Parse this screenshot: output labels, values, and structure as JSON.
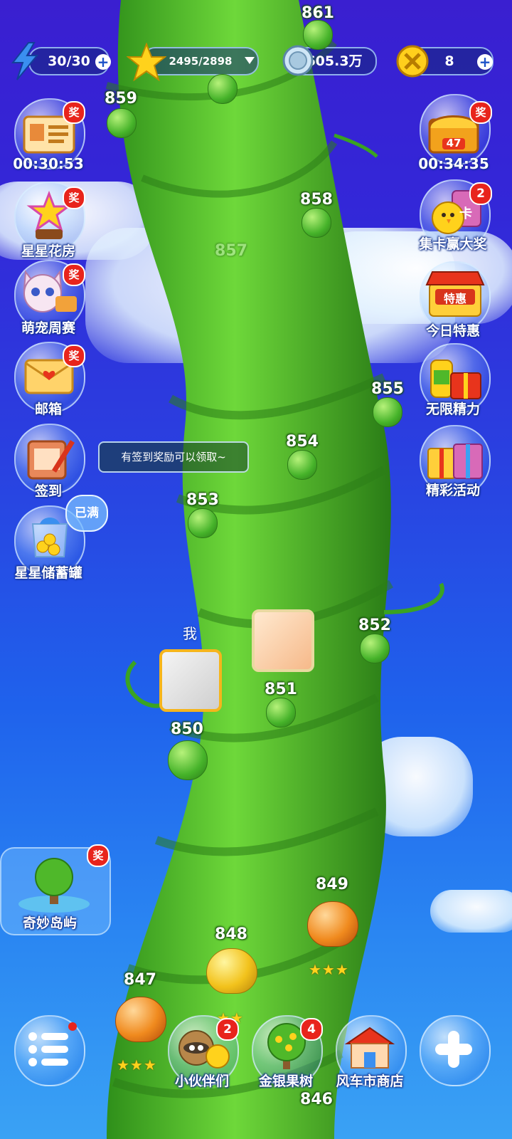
{
  "resources": {
    "energy": "30/30",
    "stars": "2495/2898",
    "coins": "605.3万",
    "tickets": "8"
  },
  "left_menu": {
    "card_timer": "00:30:53",
    "flower_house": "星星花房",
    "pet_week": "萌宠周赛",
    "mailbox": "邮箱",
    "checkin": "签到",
    "piggy_bank": "星星储蓄罐",
    "piggy_status": "已满",
    "island": "奇妙岛屿"
  },
  "right_menu": {
    "chest_timer": "00:34:35",
    "chest_level": "47",
    "collect_cards": "集卡赢大奖",
    "collect_cards_badge": "2",
    "daily_deal": "今日特惠",
    "daily_deal_sign": "特惠",
    "unlimited_energy": "无限精力",
    "events": "精彩活动"
  },
  "badges": {
    "reward": "奖",
    "card_icon": "卡"
  },
  "tooltip": "有签到奖励可以领取~",
  "me_label": "我",
  "levels": {
    "l846": "846",
    "l847": "847",
    "l848": "848",
    "l849": "849",
    "l850": "850",
    "l851": "851",
    "l852": "852",
    "l853": "853",
    "l854": "854",
    "l855": "855",
    "l857": "857",
    "l858": "858",
    "l859": "859",
    "l861": "861"
  },
  "level_stars": {
    "l847": "★★★",
    "l848": "★★",
    "l849": "★★★"
  },
  "bottom_bar": {
    "partners": "小伙伴们",
    "partners_badge": "2",
    "money_tree": "金银果树",
    "money_tree_badge": "4",
    "shop": "风车市商店"
  },
  "colors": {
    "background_top": "#3a1fd0",
    "background_bottom": "#3aa2f4",
    "stalk": "#4fc02c",
    "reward_badge": "#e8241c"
  }
}
